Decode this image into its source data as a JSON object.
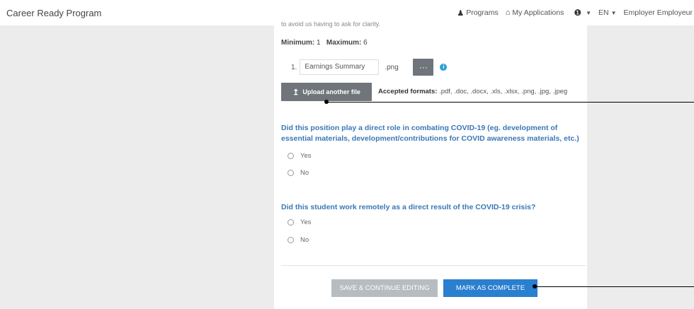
{
  "header": {
    "brand": "Career Ready Program",
    "nav": [
      {
        "icon": "user-icon",
        "label": "Programs"
      },
      {
        "icon": "home-icon",
        "label": "My Applications"
      }
    ],
    "help_icon": "info-icon",
    "language": "EN",
    "user": "Employer Employeur"
  },
  "form": {
    "cut_text": "to avoid us having to ask for clarity.",
    "minimum_label": "Minimum:",
    "minimum_value": "1",
    "maximum_label": "Maximum:",
    "maximum_value": "6",
    "file": {
      "number": "1.",
      "name": "Earnings Summary exa",
      "ext": ".png",
      "more_label": "···"
    },
    "upload_button": "Upload another file",
    "accepted_label": "Accepted formats:",
    "accepted_formats": ".pdf, .doc, .docx, .xls, .xlsx, .png, .jpg, .jpeg",
    "questions": [
      {
        "text": "Did this position play a direct role in combating COVID-19 (eg. development of essential materials, development/contributions for COVID awareness materials, etc.)",
        "options": [
          "Yes",
          "No"
        ]
      },
      {
        "text": "Did this student work remotely as a direct result of the COVID-19 crisis?",
        "options": [
          "Yes",
          "No"
        ]
      }
    ],
    "save_button": "SAVE & CONTINUE EDITING",
    "complete_button": "MARK AS COMPLETE"
  }
}
